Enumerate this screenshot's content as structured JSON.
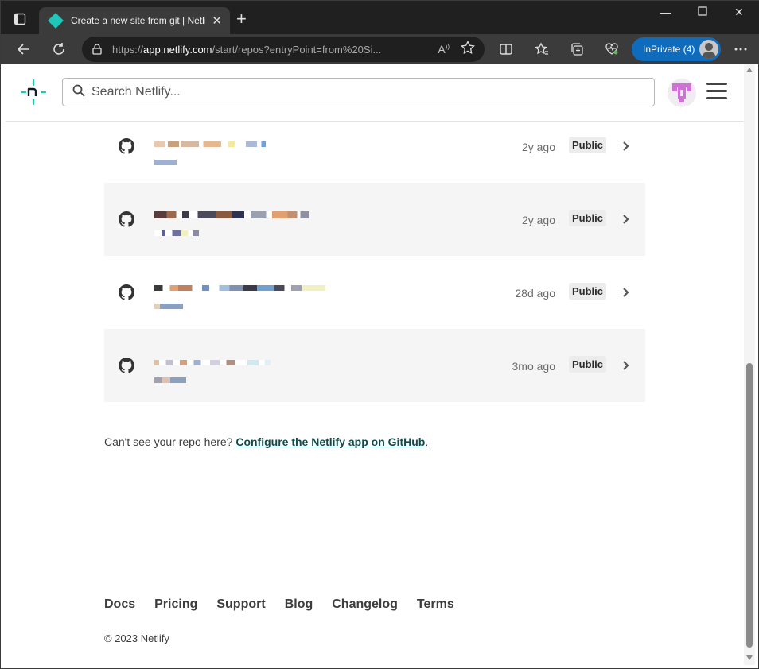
{
  "browser": {
    "tab_title": "Create a new site from git | Netlify",
    "url_prefix": "https://",
    "url_host": "app.netlify.com",
    "url_path": "/start/repos?entryPoint=from%20Si...",
    "inprivate_label": "InPrivate (4)"
  },
  "header": {
    "search_placeholder": "Search Netlify..."
  },
  "repos": [
    {
      "age": "2y ago",
      "visibility": "Public"
    },
    {
      "age": "2y ago",
      "visibility": "Public"
    },
    {
      "age": "28d ago",
      "visibility": "Public"
    },
    {
      "age": "3mo ago",
      "visibility": "Public"
    }
  ],
  "help": {
    "text": "Can't see your repo here?",
    "link": "Configure the Netlify app on GitHub",
    "suffix": "."
  },
  "footer": {
    "links": [
      "Docs",
      "Pricing",
      "Support",
      "Blog",
      "Changelog",
      "Terms"
    ],
    "copyright": "© 2023 Netlify"
  },
  "colors": {
    "netlify_teal": "#20c6b7",
    "inprivate_blue": "#0f6cbd",
    "link_dark_teal": "#0d4c4a",
    "row_alt_bg": "#f5f5f5"
  }
}
